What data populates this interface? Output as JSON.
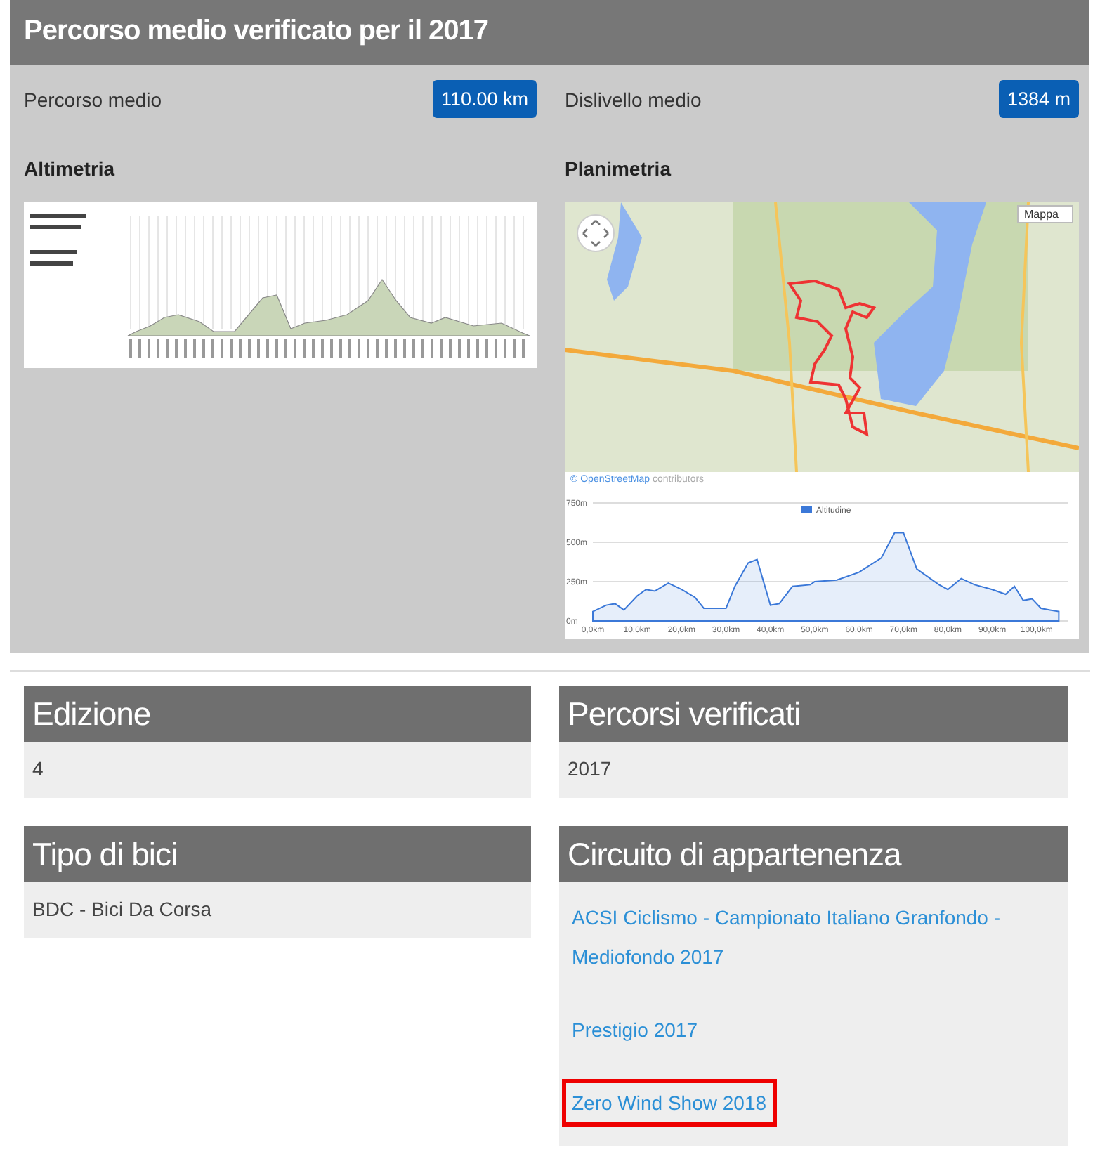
{
  "route_panel": {
    "title": "Percorso medio verificato per il 2017",
    "stats": [
      {
        "label": "Percorso medio",
        "value": "110.00 km"
      },
      {
        "label": "Dislivello medio",
        "value": "1384 m"
      }
    ],
    "altimetry": {
      "heading": "Altimetria"
    },
    "planimetry": {
      "heading": "Planimetria",
      "map_type": "Mappa",
      "attribution_link": "© OpenStreetMap",
      "attribution_text": "contributors",
      "chart_data": {
        "type": "area",
        "series": [
          {
            "name": "Altitudine",
            "color": "#3b78d8",
            "values": [
              60,
              100,
              110,
              70,
              160,
              200,
              190,
              240,
              200,
              150,
              80,
              80,
              80,
              220,
              370,
              390,
              100,
              110,
              220,
              230,
              250,
              260,
              310,
              400,
              560,
              560,
              330,
              230,
              200,
              270,
              230,
              200,
              170,
              220,
              130,
              140,
              80,
              70,
              60
            ]
          }
        ],
        "x": [
          0,
          3,
          5,
          7,
          10,
          12,
          14,
          17,
          20,
          23,
          25,
          28,
          30,
          32,
          35,
          37,
          40,
          42,
          45,
          49,
          50,
          55,
          60,
          65,
          68,
          70,
          73,
          78,
          80,
          83,
          86,
          90,
          93,
          95,
          97,
          99,
          101,
          103,
          105
        ],
        "xlim": [
          0,
          107
        ],
        "ylim": [
          0,
          750
        ],
        "xticks": [
          {
            "value": 0,
            "label": "0,0km"
          },
          {
            "value": 10,
            "label": "10,0km"
          },
          {
            "value": 20,
            "label": "20,0km"
          },
          {
            "value": 30,
            "label": "30,0km"
          },
          {
            "value": 40,
            "label": "40,0km"
          },
          {
            "value": 50,
            "label": "50,0km"
          },
          {
            "value": 60,
            "label": "60,0km"
          },
          {
            "value": 70,
            "label": "70,0km"
          },
          {
            "value": 80,
            "label": "80,0km"
          },
          {
            "value": 90,
            "label": "90,0km"
          },
          {
            "value": 100,
            "label": "100,0km"
          }
        ],
        "yticks": [
          {
            "value": 0,
            "label": "0m"
          },
          {
            "value": 250,
            "label": "250m"
          },
          {
            "value": 500,
            "label": "500m"
          },
          {
            "value": 750,
            "label": "750m"
          }
        ]
      }
    }
  },
  "cards": [
    {
      "title": "Edizione",
      "kind": "text",
      "items": [
        {
          "text": "4"
        }
      ]
    },
    {
      "title": "Percorsi verificati",
      "kind": "text",
      "items": [
        {
          "text": "2017"
        }
      ]
    },
    {
      "title": "Tipo di bici",
      "kind": "text",
      "items": [
        {
          "text": "BDC - Bici Da Corsa"
        }
      ]
    },
    {
      "title": "Circuito di appartenenza",
      "kind": "links",
      "items": [
        {
          "text": "ACSI Ciclismo - Campionato Italiano Granfondo - Mediofondo 2017",
          "highlighted": false
        },
        {
          "text": "Prestigio 2017",
          "highlighted": false
        },
        {
          "text": "Zero Wind Show 2018",
          "highlighted": true
        }
      ]
    }
  ]
}
